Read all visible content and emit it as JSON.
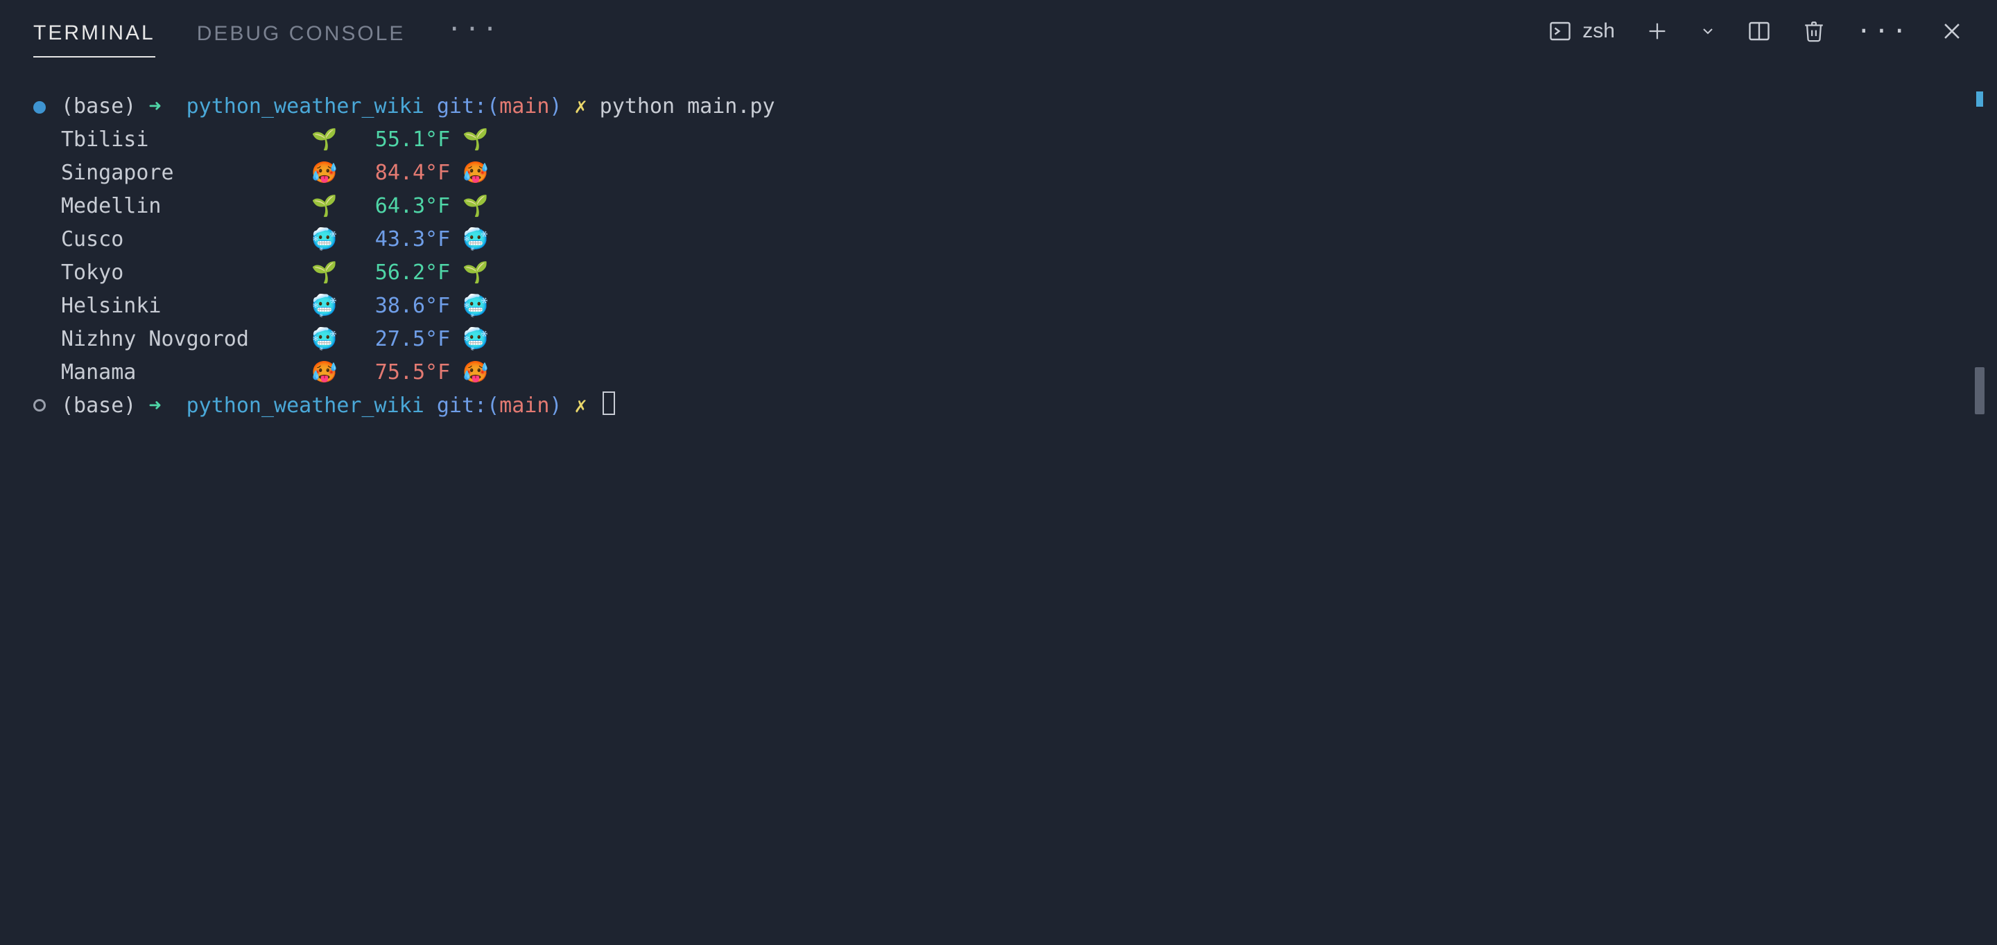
{
  "tabs": {
    "terminal": "TERMINAL",
    "debug_console": "DEBUG CONSOLE",
    "overflow": "···"
  },
  "toolbar": {
    "shell": "zsh"
  },
  "prompt": {
    "base": "(base)",
    "arrow": "➜",
    "cwd": "python_weather_wiki",
    "git_label": "git:",
    "paren_open": "(",
    "branch": "main",
    "paren_close": ")",
    "dirty": "✗",
    "command": "python main.py"
  },
  "output": [
    {
      "city": "Tbilisi",
      "emoji": "🌱",
      "temp": "55.1°F",
      "kind": "mild"
    },
    {
      "city": "Singapore",
      "emoji": "🥵",
      "temp": "84.4°F",
      "kind": "hot"
    },
    {
      "city": "Medellin",
      "emoji": "🌱",
      "temp": "64.3°F",
      "kind": "mild"
    },
    {
      "city": "Cusco",
      "emoji": "🥶",
      "temp": "43.3°F",
      "kind": "cold"
    },
    {
      "city": "Tokyo",
      "emoji": "🌱",
      "temp": "56.2°F",
      "kind": "mild"
    },
    {
      "city": "Helsinki",
      "emoji": "🥶",
      "temp": "38.6°F",
      "kind": "cold"
    },
    {
      "city": "Nizhny Novgorod",
      "emoji": "🥶",
      "temp": "27.5°F",
      "kind": "cold"
    },
    {
      "city": "Manama",
      "emoji": "🥵",
      "temp": "75.5°F",
      "kind": "hot"
    }
  ]
}
